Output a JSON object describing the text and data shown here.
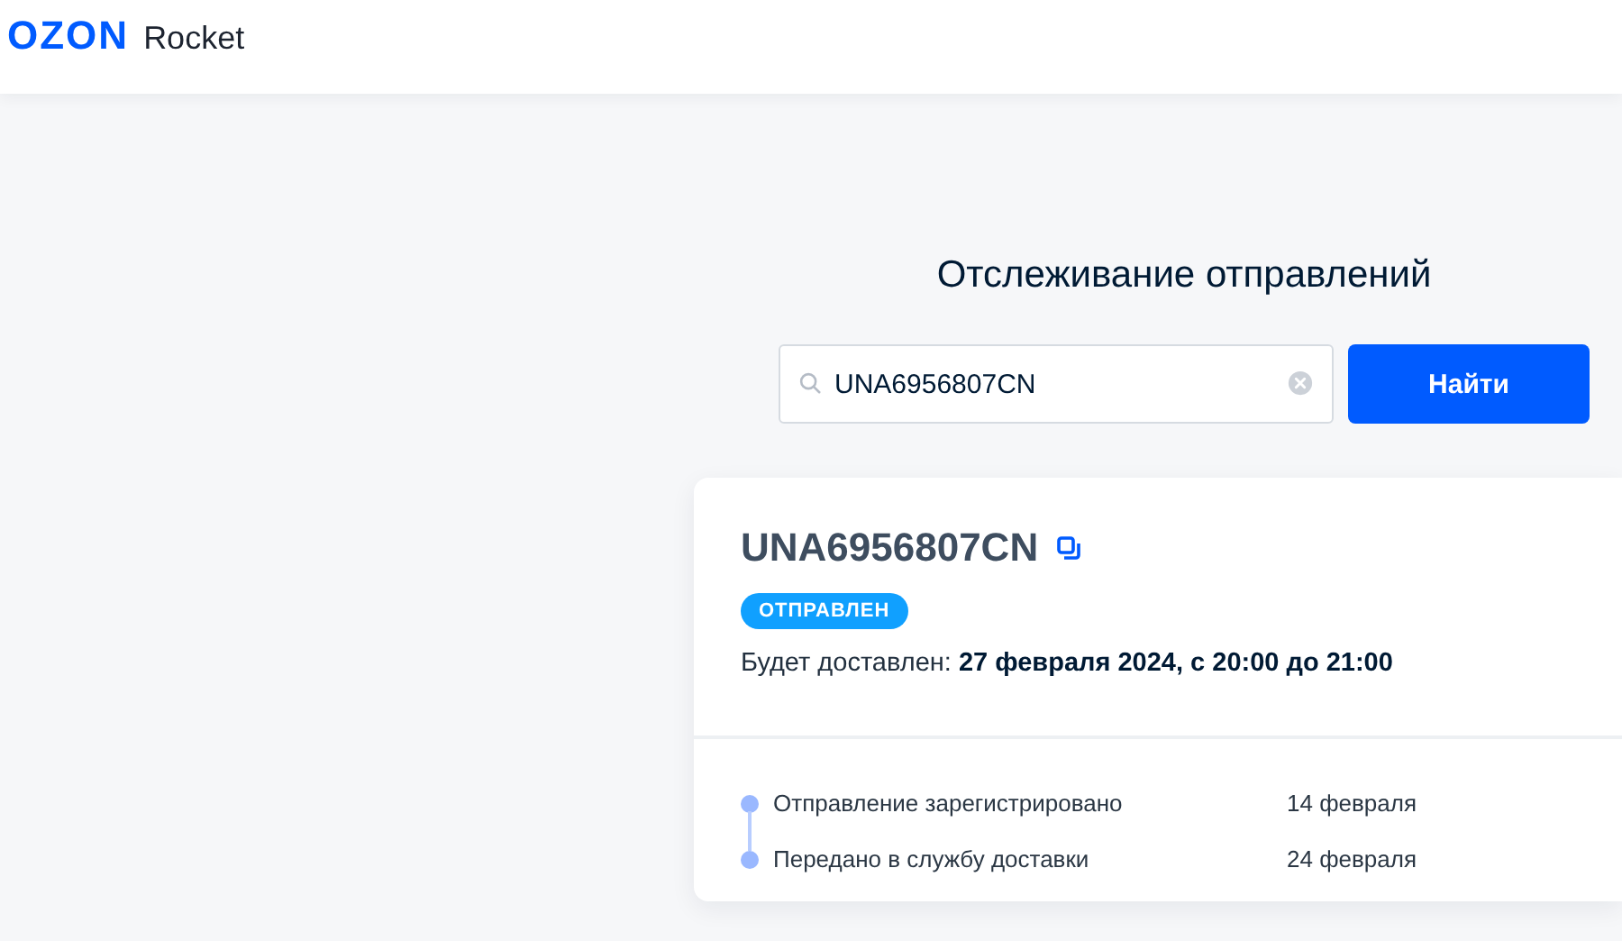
{
  "header": {
    "logo": "OZON",
    "product": "Rocket"
  },
  "title": "Отслеживание отправлений",
  "search": {
    "value": "UNA6956807CN",
    "button": "Найти"
  },
  "parcel": {
    "number": "UNA6956807CN",
    "status": "ОТПРАВЛЕН",
    "delivery": "Будет доставлен: **27 февраля 2024, с 20:00 до 21:00**",
    "events": [
      {
        "label": "Отправление зарегистрировано",
        "date": "14 февраля"
      },
      {
        "label": "Передано в службу доставки",
        "date": "24 февраля"
      }
    ]
  }
}
